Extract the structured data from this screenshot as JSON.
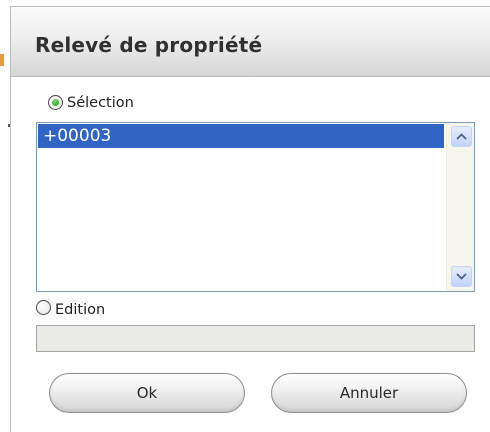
{
  "dialog": {
    "title": "Relevé de propriété"
  },
  "selection": {
    "label": "Sélection",
    "checked": true,
    "items": [
      "+00003"
    ],
    "selected_item": "+00003"
  },
  "edition": {
    "label": "Edition",
    "checked": false,
    "value": ""
  },
  "buttons": {
    "ok_label": "Ok",
    "cancel_label": "Annuler"
  },
  "icons": {
    "scroll_up": "chevron-up-icon",
    "scroll_down": "chevron-down-icon"
  },
  "colors": {
    "selection_highlight": "#3165c5",
    "radio_checked": "#2f9a27",
    "listbox_border": "#7f9db9",
    "scroll_button": "#c1d3fb"
  }
}
